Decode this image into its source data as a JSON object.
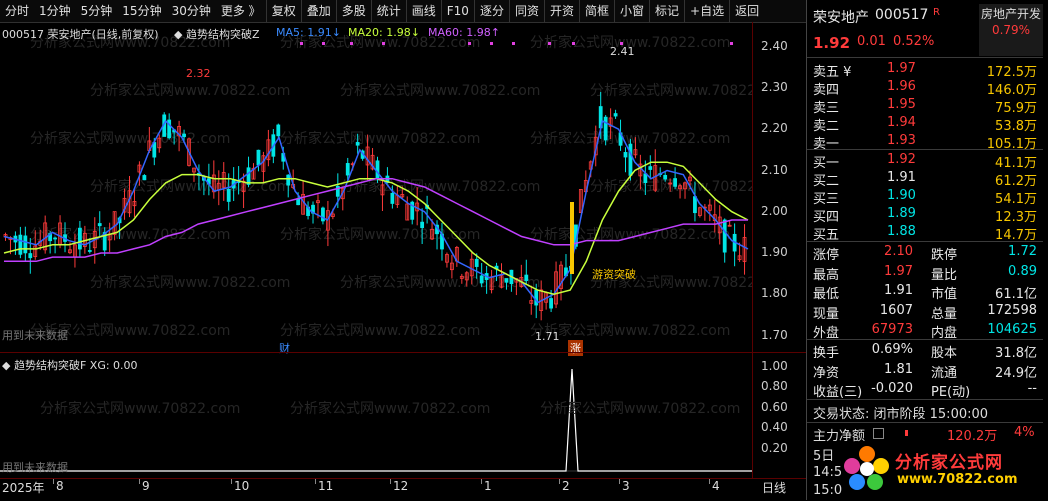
{
  "toolbar": {
    "items": [
      "分时",
      "1分钟",
      "5分钟",
      "15分钟",
      "30分钟",
      "更多 》",
      "复权",
      "叠加",
      "多股",
      "统计",
      "画线",
      "F10",
      "逐分",
      "同资",
      "开资",
      "简框",
      "小窗",
      "标记",
      "+自选",
      "返回"
    ]
  },
  "main_legend": {
    "code_name": "000517 荣安地产(日线,前复权)",
    "indicator": "◆ 趋势结构突破Z",
    "ma5": "MA5: 1.91↓",
    "ma20": "MA20: 1.98↓",
    "ma60": "MA60: 1.98↑",
    "future_note": "用到未来数据",
    "signal_label": "游资突破",
    "high_mark": "2.32",
    "peak_mark": "2.41",
    "low_mark": "1.71",
    "badge_cai": "财",
    "badge_zhang": "涨"
  },
  "sub_legend": {
    "title": "◆ 趋势结构突破F XG: 0.00",
    "future_note": "用到未来数据"
  },
  "price_axis": [
    "2.40",
    "2.30",
    "2.20",
    "2.10",
    "2.00",
    "1.90",
    "1.80",
    "1.70"
  ],
  "sub_axis": [
    "1.00",
    "0.80",
    "0.60",
    "0.40",
    "0.20"
  ],
  "time_axis": {
    "labels": [
      "2025年",
      "8",
      "9",
      "10",
      "11",
      "12",
      "1",
      "2",
      "3",
      "4",
      "日线"
    ]
  },
  "watermark": "分析家公式网www.70822.com",
  "colors": {
    "up": "#ff3b3b",
    "down": "#00e5e5",
    "ma5": "#3366ff",
    "ma20": "#c8ff3c",
    "ma60": "#c040ff"
  },
  "chart_data": {
    "type": "line",
    "series": [
      {
        "name": "MA5",
        "values": [
          1.94,
          1.93,
          1.92,
          1.95,
          1.93,
          1.92,
          1.94,
          1.97,
          2.05,
          2.15,
          2.22,
          2.18,
          2.1,
          2.05,
          2.06,
          2.09,
          2.12,
          2.18,
          2.05,
          2.0,
          1.98,
          2.05,
          2.15,
          2.1,
          2.05,
          2.02,
          2.0,
          1.95,
          1.88,
          1.86,
          1.84,
          1.85,
          1.83,
          1.78,
          1.8,
          1.86,
          2.05,
          2.22,
          2.2,
          2.12,
          2.08,
          2.1,
          2.09,
          2.02,
          1.98,
          1.93,
          1.91
        ]
      },
      {
        "name": "MA20",
        "values": [
          1.9,
          1.91,
          1.91,
          1.92,
          1.92,
          1.93,
          1.94,
          1.95,
          1.98,
          2.03,
          2.07,
          2.09,
          2.09,
          2.08,
          2.08,
          2.07,
          2.07,
          2.08,
          2.08,
          2.07,
          2.06,
          2.07,
          2.08,
          2.08,
          2.07,
          2.05,
          2.02,
          1.98,
          1.94,
          1.9,
          1.87,
          1.85,
          1.83,
          1.81,
          1.8,
          1.81,
          1.88,
          1.98,
          2.05,
          2.1,
          2.12,
          2.12,
          2.11,
          2.07,
          2.03,
          2.0,
          1.98
        ]
      },
      {
        "name": "MA60",
        "values": [
          1.88,
          1.88,
          1.88,
          1.89,
          1.89,
          1.89,
          1.9,
          1.9,
          1.91,
          1.92,
          1.94,
          1.95,
          1.97,
          1.98,
          1.99,
          2.0,
          2.01,
          2.02,
          2.03,
          2.04,
          2.05,
          2.06,
          2.07,
          2.08,
          2.08,
          2.07,
          2.06,
          2.04,
          2.02,
          2.0,
          1.98,
          1.96,
          1.94,
          1.93,
          1.92,
          1.92,
          1.93,
          1.93,
          1.93,
          1.94,
          1.95,
          1.96,
          1.97,
          1.97,
          1.97,
          1.98,
          1.98
        ]
      }
    ],
    "ylim": [
      1.66,
      2.46
    ]
  },
  "panel": {
    "title_name": "荣安地产",
    "title_code": "000517",
    "title_flag": "R",
    "industry": "房地产开发",
    "industry_pct": "0.79%",
    "price": "1.92",
    "change": "0.01",
    "change_pct": "0.52%",
    "asks": [
      {
        "label": "卖五 ¥",
        "price": "1.97",
        "vol": "172.5万"
      },
      {
        "label": "卖四",
        "price": "1.96",
        "vol": "146.0万"
      },
      {
        "label": "卖三",
        "price": "1.95",
        "vol": "75.9万"
      },
      {
        "label": "卖二",
        "price": "1.94",
        "vol": "53.8万"
      },
      {
        "label": "卖一",
        "price": "1.93",
        "vol": "105.1万"
      }
    ],
    "bids": [
      {
        "label": "买一",
        "price": "1.92",
        "vol": "41.1万"
      },
      {
        "label": "买二",
        "price": "1.91",
        "vol": "61.2万"
      },
      {
        "label": "买三",
        "price": "1.90",
        "vol": "54.1万"
      },
      {
        "label": "买四",
        "price": "1.89",
        "vol": "12.3万"
      },
      {
        "label": "买五",
        "price": "1.88",
        "vol": "14.7万"
      }
    ],
    "stats": [
      {
        "l1": "涨停",
        "v1": "2.10",
        "c1": "red",
        "l2": "跌停",
        "v2": "1.72",
        "c2": "green"
      },
      {
        "l1": "最高",
        "v1": "1.97",
        "c1": "red",
        "l2": "量比",
        "v2": "0.89",
        "c2": "green"
      },
      {
        "l1": "最低",
        "v1": "1.91",
        "c1": "white",
        "l2": "市值",
        "v2": "61.1亿",
        "c2": "white"
      },
      {
        "l1": "现量",
        "v1": "1607",
        "c1": "white",
        "l2": "总量",
        "v2": "172598",
        "c2": "white"
      },
      {
        "l1": "外盘",
        "v1": "67973",
        "c1": "red",
        "l2": "内盘",
        "v2": "104625",
        "c2": "green"
      }
    ],
    "stats2": [
      {
        "l1": "换手",
        "v1": "0.69%",
        "l2": "股本",
        "v2": "31.8亿"
      },
      {
        "l1": "净资",
        "v1": "1.81",
        "l2": "流通",
        "v2": "24.9亿"
      },
      {
        "l1": "收益(三)",
        "v1": "-0.020",
        "l2": "PE(动)",
        "v2": "--"
      }
    ],
    "trade_state": "交易状态: 闭市阶段 15:00:00",
    "main_net_label": "主力净额",
    "main_net_value": "120.2万",
    "main_net_pct": "4%",
    "day5": "5日",
    "t1": "14:5",
    "t2": "15:0",
    "logo_text": "分析家公式网",
    "logo_url": "www.70822.com"
  }
}
